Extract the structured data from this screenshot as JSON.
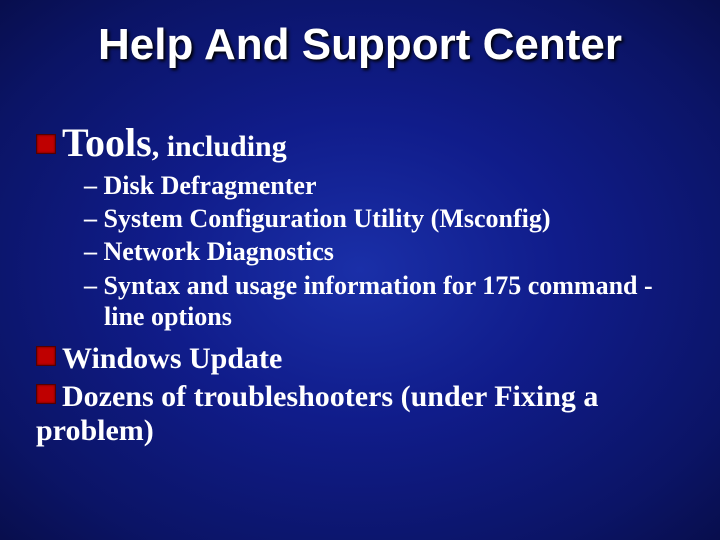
{
  "title": "Help And Support Center",
  "items": [
    {
      "prefix": "Tools",
      "suffix": ", including",
      "sub": [
        "Disk Defragmenter",
        "System Configuration Utility (Msconfig)",
        "Network Diagnostics",
        "Syntax and usage information for 175 command -line options"
      ]
    },
    {
      "text": "Windows Update"
    },
    {
      "text": "Dozens of troubleshooters (under Fixing a problem)"
    }
  ],
  "dash": "– "
}
